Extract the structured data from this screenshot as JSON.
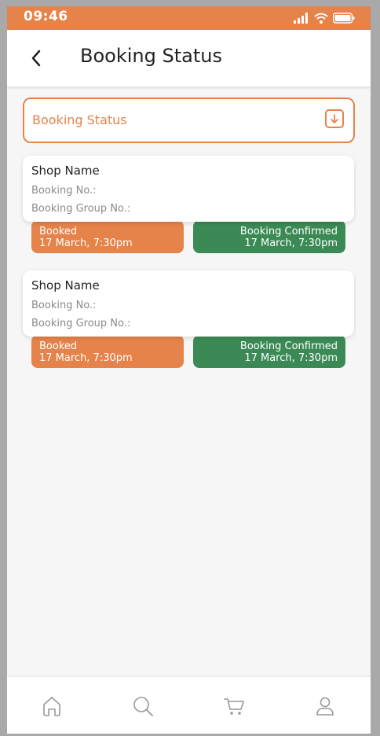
{
  "status_bar": {
    "time": "09:46"
  },
  "header": {
    "title": "Booking Status"
  },
  "dropdown": {
    "label": "Booking Status"
  },
  "bookings": [
    {
      "shop_name": "Shop Name",
      "booking_no": "Booking No.:",
      "booking_group_no": "Booking Group No.:",
      "booked_label": "Booked",
      "booked_time": "17 March, 7:30pm",
      "confirmed_label": "Booking Confirmed",
      "confirmed_time": "17 March, 7:30pm"
    },
    {
      "shop_name": "Shop Name",
      "booking_no": "Booking No.:",
      "booking_group_no": "Booking Group No.:",
      "booked_label": "Booked",
      "booked_time": "17 March, 7:30pm",
      "confirmed_label": "Booking Confirmed",
      "confirmed_time": "17 March, 7:30pm"
    }
  ],
  "bottom_nav": {
    "items": [
      {
        "icon": "home-icon"
      },
      {
        "icon": "search-icon"
      },
      {
        "icon": "cart-icon"
      },
      {
        "icon": "profile-icon"
      }
    ]
  },
  "colors": {
    "accent": "#e5834a",
    "confirmed": "#3b8a55"
  }
}
